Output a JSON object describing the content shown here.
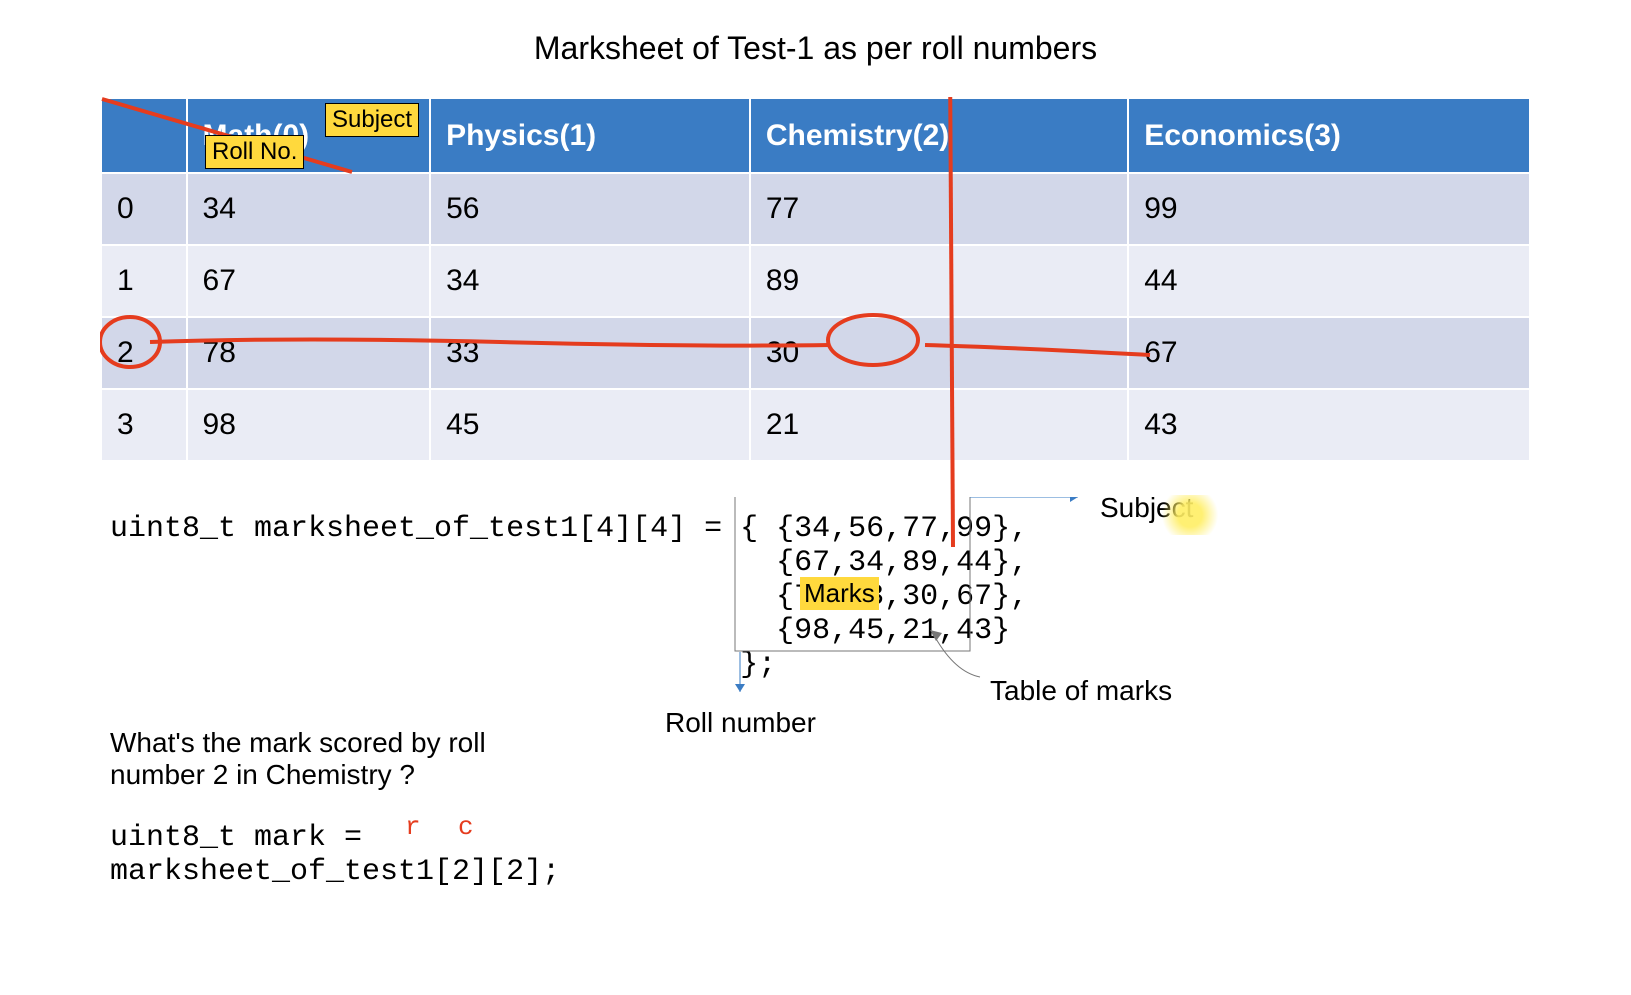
{
  "title": "Marksheet of Test-1 as per roll numbers",
  "table": {
    "corner_labels": {
      "subject": "Subject",
      "rollno": "Roll No."
    },
    "headers": [
      "Math(0)",
      "Physics(1)",
      "Chemistry(2)",
      "Economics(3)"
    ],
    "rows": [
      {
        "roll": "0",
        "marks": [
          "34",
          "56",
          "77",
          "99"
        ]
      },
      {
        "roll": "1",
        "marks": [
          "67",
          "34",
          "89",
          "44"
        ]
      },
      {
        "roll": "2",
        "marks": [
          "78",
          "33",
          "30",
          "67"
        ]
      },
      {
        "roll": "3",
        "marks": [
          "98",
          "45",
          "21",
          "43"
        ]
      }
    ]
  },
  "code": {
    "declaration": "uint8_t marksheet_of_test1[4][4] = { {34,56,77,99},\n                                     {67,34,89,44},\n                                     {78,33,30,67},\n                                     {98,45,21,43}\n                                   };",
    "question": "What's the mark scored by roll number 2 in Chemistry ?",
    "answer": "uint8_t mark =\nmarksheet_of_test1[2][2];",
    "marks_label": "Marks",
    "subject_label": "Subject",
    "rollnumber_label": "Roll number",
    "tablemarks_label": "Table of marks",
    "r_annotation": "r",
    "c_annotation": "c"
  },
  "chart_data": {
    "type": "table",
    "title": "Marksheet of Test-1 as per roll numbers",
    "row_label": "Roll No.",
    "column_label": "Subject",
    "columns": [
      "Math(0)",
      "Physics(1)",
      "Chemistry(2)",
      "Economics(3)"
    ],
    "rows": [
      "0",
      "1",
      "2",
      "3"
    ],
    "data": [
      [
        34,
        56,
        77,
        99
      ],
      [
        67,
        34,
        89,
        44
      ],
      [
        78,
        33,
        30,
        67
      ],
      [
        98,
        45,
        21,
        43
      ]
    ]
  }
}
